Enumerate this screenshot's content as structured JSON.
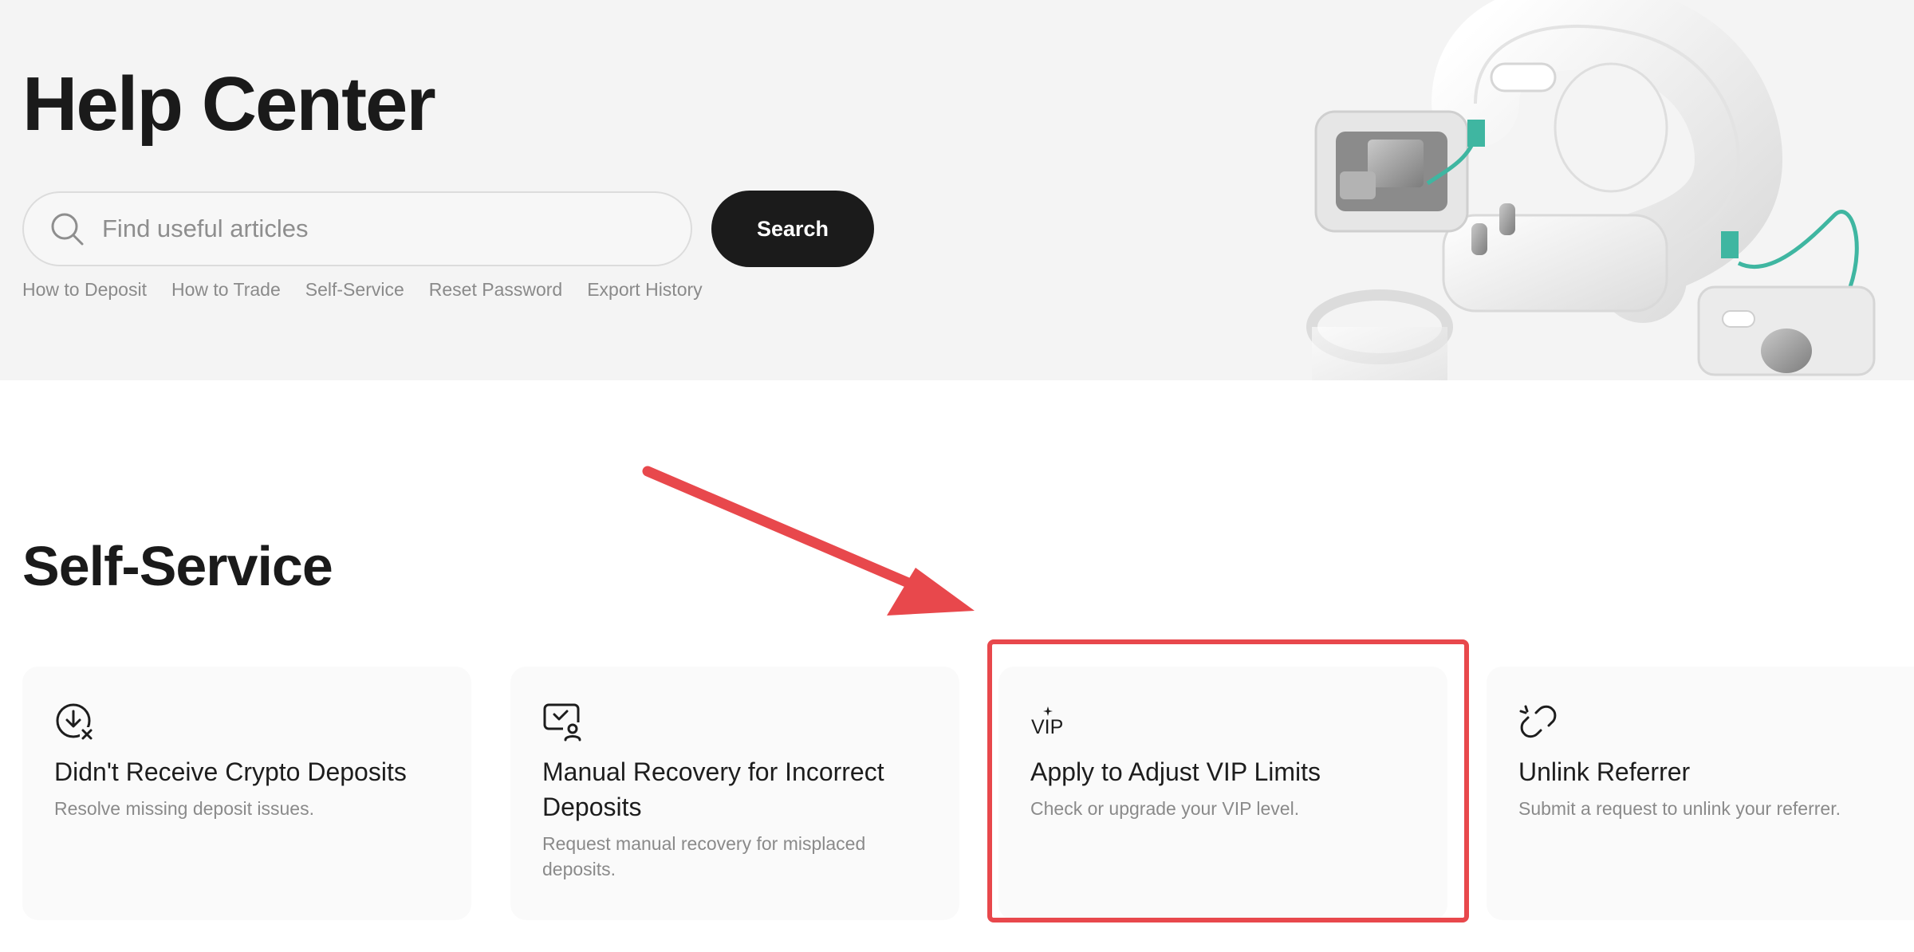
{
  "hero": {
    "title": "Help Center",
    "search": {
      "placeholder": "Find useful articles",
      "value": "",
      "button_label": "Search"
    },
    "quick_links": [
      "How to Deposit",
      "How to Trade",
      "Self-Service",
      "Reset Password",
      "Export History"
    ],
    "illustration": "3d-question-mark-hardware-illustration"
  },
  "self_service": {
    "title": "Self-Service",
    "cards": [
      {
        "icon": "download-x-icon",
        "title": "Didn't Receive Crypto Deposits",
        "description": "Resolve missing deposit issues."
      },
      {
        "icon": "monitor-user-icon",
        "title": "Manual Recovery for Incorrect Deposits",
        "description": "Request manual recovery for misplaced deposits."
      },
      {
        "icon": "vip-icon",
        "icon_text": "VIP",
        "title": "Apply to Adjust VIP Limits",
        "description": "Check or upgrade your VIP level."
      },
      {
        "icon": "broken-link-icon",
        "title": "Unlink Referrer",
        "description": "Submit a request to unlink your referrer."
      }
    ]
  },
  "annotation": {
    "type": "red-arrow-and-highlight-box",
    "target": "Apply to Adjust VIP Limits",
    "color": "#e8484c"
  },
  "colors": {
    "hero_background": "#f4f4f4",
    "button_background": "#1b1b1b",
    "card_background": "#fafafa",
    "muted_text": "#8a8a8a",
    "accent_teal": "#3fb6a1"
  }
}
